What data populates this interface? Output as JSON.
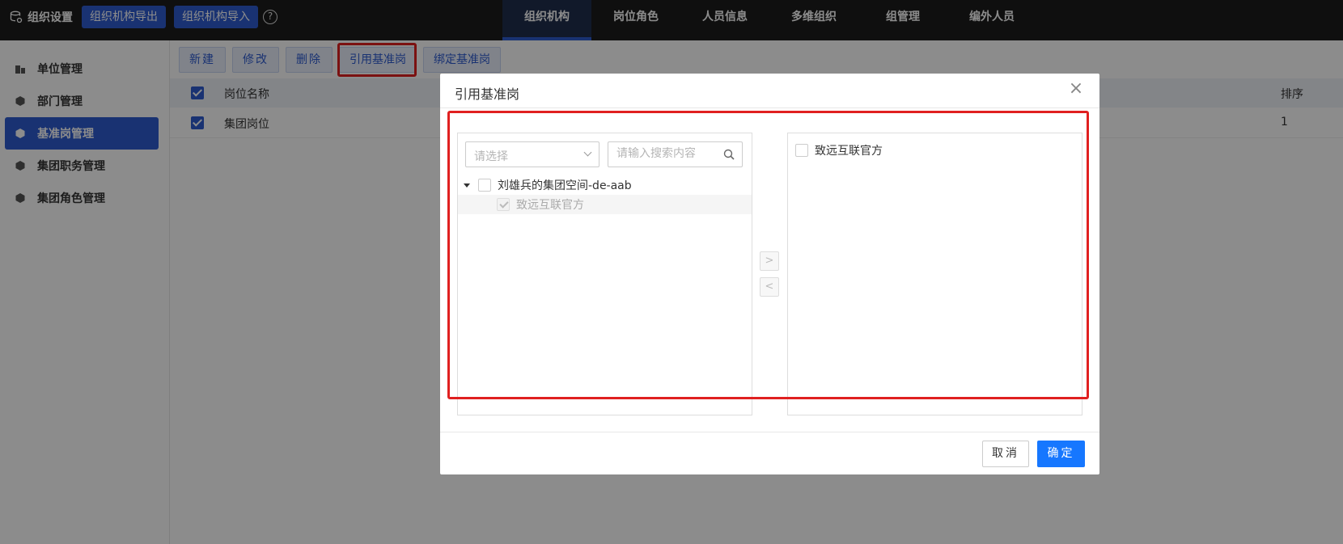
{
  "topbar": {
    "brand": "组织设置",
    "export_label": "组织机构导出",
    "import_label": "组织机构导入",
    "help": "?",
    "tabs": [
      {
        "label": "组织机构",
        "active": true
      },
      {
        "label": "岗位角色",
        "active": false
      },
      {
        "label": "人员信息",
        "active": false
      },
      {
        "label": "多维组织",
        "active": false
      },
      {
        "label": "组管理",
        "active": false
      },
      {
        "label": "编外人员",
        "active": false
      }
    ]
  },
  "sidebar": {
    "items": [
      {
        "label": "单位管理",
        "active": false
      },
      {
        "label": "部门管理",
        "active": false
      },
      {
        "label": "基准岗管理",
        "active": true
      },
      {
        "label": "集团职务管理",
        "active": false
      },
      {
        "label": "集团角色管理",
        "active": false
      }
    ]
  },
  "toolbar": {
    "new": "新建",
    "edit": "修改",
    "delete": "删除",
    "reference": "引用基准岗",
    "bind": "绑定基准岗"
  },
  "table": {
    "headers": {
      "name": "岗位名称",
      "order": "排序"
    },
    "rows": [
      {
        "name": "集团岗位",
        "order": "1",
        "checked": true
      }
    ]
  },
  "dialog": {
    "title": "引用基准岗",
    "close": "×",
    "select_placeholder": "请选择",
    "search_placeholder": "请输入搜索内容",
    "tree": {
      "root": "刘雄兵的集团空间-de-aab",
      "child": "致远互联官方"
    },
    "selected": [
      "致远互联官方"
    ],
    "move_right": ">",
    "move_left": "<",
    "cancel": "取消",
    "ok": "确定"
  }
}
